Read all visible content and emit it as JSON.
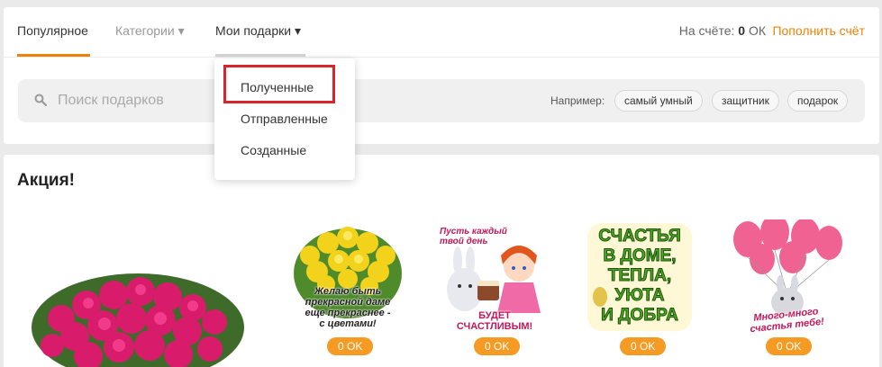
{
  "tabs": [
    {
      "label": "Популярное"
    },
    {
      "label": "Категории ▾"
    },
    {
      "label": "Мои подарки ▾"
    }
  ],
  "balance": {
    "prefix": "На счёте:",
    "amount": "0",
    "unit": "ОК"
  },
  "topup_label": "Пополнить счёт",
  "search": {
    "placeholder": "Поиск подарков"
  },
  "examples": {
    "label": "Например:",
    "chips": [
      "самый умный",
      "защитник",
      "подарок"
    ]
  },
  "dropdown": {
    "items": [
      "Полученные",
      "Отправленные",
      "Созданные"
    ]
  },
  "promo": {
    "title": "Акция!",
    "gifts": [
      {
        "caption": [
          "Желаю быть",
          "прекрасной даме",
          "еще прекраснее -",
          "с цветами!"
        ],
        "price": "0 OK"
      },
      {
        "caption_top": [
          "Пусть каждый",
          "твой день"
        ],
        "caption_bottom": [
          "БУДЕТ",
          "СЧАСТЛИВЫМ!"
        ],
        "price": "0 OK"
      },
      {
        "caption": [
          "СЧАСТЬЯ",
          "В ДОМЕ,",
          "ТЕПЛА,",
          "УЮТА",
          "И ДОБРА"
        ],
        "price": "0 OK"
      },
      {
        "caption": [
          "Много-много",
          "счастья тебе!"
        ],
        "price": "0 OK"
      }
    ]
  },
  "colors": {
    "accent": "#ee8208",
    "price_bg": "#f59a23",
    "highlight": "#d9242b"
  }
}
